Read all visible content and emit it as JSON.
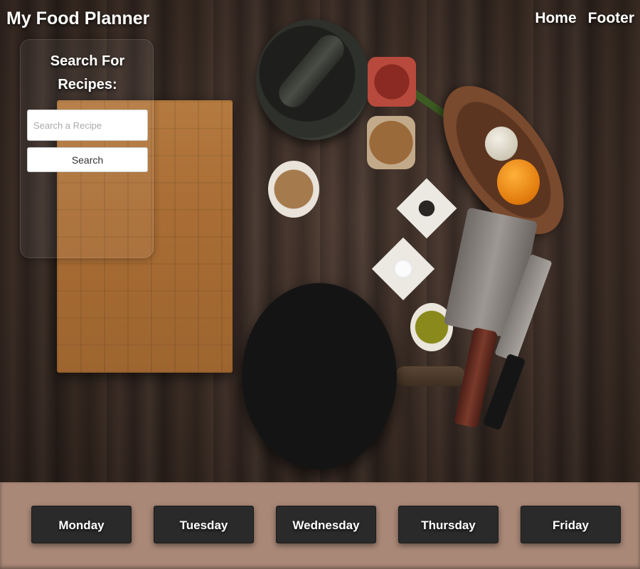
{
  "header": {
    "brand": "My Food Planner",
    "nav": [
      "Home",
      "Footer"
    ]
  },
  "search": {
    "title": "Search For Recipes:",
    "placeholder": "Search a Recipe",
    "button_label": "Search"
  },
  "days": [
    "Monday",
    "Tuesday",
    "Wednesday",
    "Thursday",
    "Friday"
  ],
  "colors": {
    "footer_bg": "#a98877",
    "day_button_bg": "#2a2a2a",
    "text_light": "#ffffff"
  }
}
